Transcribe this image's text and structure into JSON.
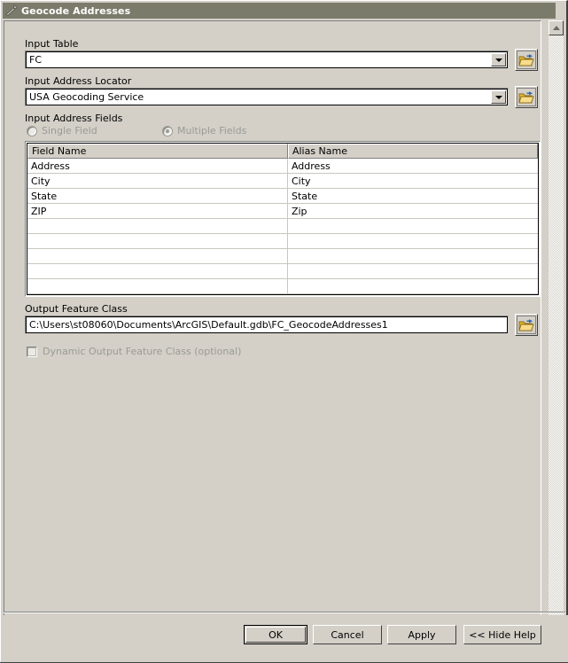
{
  "window": {
    "title": "Geocode Addresses",
    "icon": "hammer-tool-icon"
  },
  "form": {
    "input_table": {
      "label": "Input Table",
      "value": "FC",
      "browse_icon": "open-folder-icon"
    },
    "input_address_locator": {
      "label": "Input Address Locator",
      "value": "USA Geocoding Service",
      "browse_icon": "open-folder-icon"
    },
    "input_address_fields": {
      "label": "Input Address Fields",
      "options": [
        {
          "label": "Single Field",
          "selected": false,
          "enabled": false
        },
        {
          "label": "Multiple Fields",
          "selected": true,
          "enabled": false
        }
      ]
    },
    "field_table": {
      "columns": [
        "Field Name",
        "Alias Name"
      ],
      "rows": [
        [
          "Address",
          "Address"
        ],
        [
          "City",
          "City"
        ],
        [
          "State",
          "State"
        ],
        [
          "ZIP",
          "Zip"
        ],
        [
          "",
          ""
        ],
        [
          "",
          ""
        ],
        [
          "",
          ""
        ],
        [
          "",
          ""
        ],
        [
          "",
          ""
        ]
      ]
    },
    "output_feature_class": {
      "label": "Output Feature Class",
      "value": "C:\\Users\\st08060\\Documents\\ArcGIS\\Default.gdb\\FC_GeocodeAddresses1",
      "browse_icon": "open-folder-icon"
    },
    "dynamic_output": {
      "label": "Dynamic Output Feature Class (optional)",
      "checked": false,
      "enabled": false
    }
  },
  "scrollbar": {
    "up_icon": "scroll-up-arrow-icon",
    "down_icon": "scroll-down-arrow-icon"
  },
  "buttons": {
    "ok": "OK",
    "cancel": "Cancel",
    "apply": "Apply",
    "hide_help": "<< Hide Help"
  },
  "colors": {
    "dialog_face": "#d4d0c8",
    "titlebar": "#7b7b6b",
    "field_bg": "#ffffff",
    "disabled_text": "#9a9a94",
    "folder_yellow": "#f5d76e",
    "folder_arrow_blue": "#2c5fa8"
  }
}
